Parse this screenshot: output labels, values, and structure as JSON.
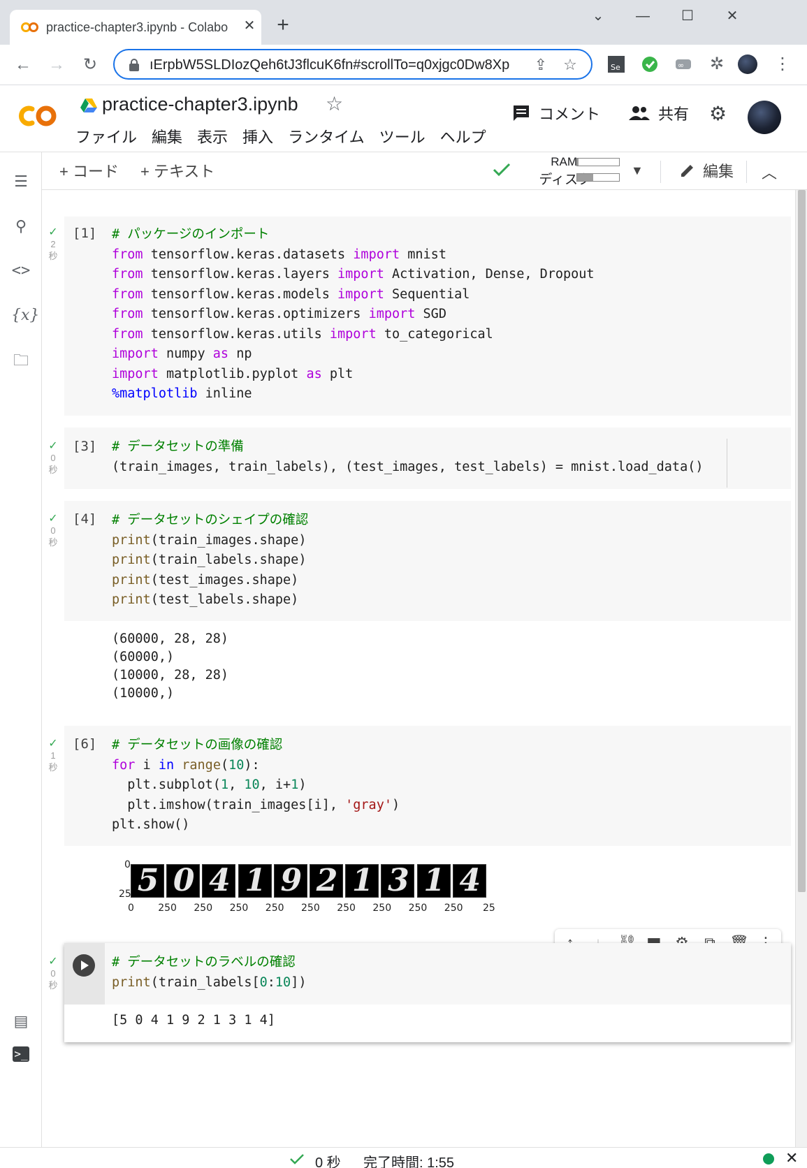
{
  "browser": {
    "tab_title": "practice-chapter3.ipynb - Colabo",
    "tab_close": "✕",
    "new_tab": "+",
    "url": "ıErpbW5SLDIozQeh6tJ3flcuK6fn#scrollTo=q0xjgc0Dw8Xp",
    "window_controls": [
      "⌄",
      "—",
      "☐",
      "✕"
    ]
  },
  "colab": {
    "notebook_title": "practice-chapter3.ipynb",
    "menu": [
      "ファイル",
      "編集",
      "表示",
      "挿入",
      "ランタイム",
      "ツール",
      "ヘルプ"
    ],
    "comment_label": "コメント",
    "share_label": "共有",
    "add_code_label": "+ コード",
    "add_text_label": "+ テキスト",
    "ram_label": "RAM",
    "disk_label": "ディスク",
    "ram_usage": 0.03,
    "disk_usage": 0.38,
    "edit_label": "編集"
  },
  "cells": [
    {
      "exec_count": "[1]",
      "status_time": "2",
      "status_unit": "秒"
    },
    {
      "exec_count": "[3]",
      "status_time": "0",
      "status_unit": "秒"
    },
    {
      "exec_count": "[4]",
      "status_time": "0",
      "status_unit": "秒"
    },
    {
      "exec_count": "[6]",
      "status_time": "1",
      "status_unit": "秒"
    },
    {
      "exec_count": "",
      "status_time": "0",
      "status_unit": "秒"
    }
  ],
  "code": {
    "c1_l1": "# パッケージのインポート",
    "c1_l2a": "from",
    "c1_l2b": " tensorflow.keras.datasets ",
    "c1_l2c": "import",
    "c1_l2d": " mnist",
    "c1_l3a": "from",
    "c1_l3b": " tensorflow.keras.layers ",
    "c1_l3c": "import",
    "c1_l3d": " Activation, Dense, Dropout",
    "c1_l4a": "from",
    "c1_l4b": " tensorflow.keras.models ",
    "c1_l4c": "import",
    "c1_l4d": " Sequential",
    "c1_l5a": "from",
    "c1_l5b": " tensorflow.keras.optimizers ",
    "c1_l5c": "import",
    "c1_l5d": " SGD",
    "c1_l6a": "from",
    "c1_l6b": " tensorflow.keras.utils ",
    "c1_l6c": "import",
    "c1_l6d": " to_categorical",
    "c1_l7a": "import",
    "c1_l7b": " numpy ",
    "c1_l7c": "as",
    "c1_l7d": " np",
    "c1_l8a": "import",
    "c1_l8b": " matplotlib.pyplot ",
    "c1_l8c": "as",
    "c1_l8d": " plt",
    "c1_l9a": "%matplotlib",
    "c1_l9b": " inline",
    "c2_l1": "# データセットの準備",
    "c2_l2": "(train_images, train_labels), (test_images, test_labels) = mnist.load_data()",
    "c3_l1": "# データセットのシェイプの確認",
    "c3_fn": "print",
    "c3_l2": "(train_images.shape)",
    "c3_l3": "(train_labels.shape)",
    "c3_l4": "(test_images.shape)",
    "c3_l5": "(test_labels.shape)",
    "c4_l1": "# データセットの画像の確認",
    "c4_l2a": "for",
    "c4_l2b": " i ",
    "c4_l2c": "in",
    "c4_l2d": " ",
    "c4_l2e": "range",
    "c4_l2f": "(",
    "c4_l2g": "10",
    "c4_l2h": "):",
    "c4_l3a": "  plt.subplot(",
    "c4_l3b": "1",
    "c4_l3c": ", ",
    "c4_l3d": "10",
    "c4_l3e": ", i+",
    "c4_l3f": "1",
    "c4_l3g": ")",
    "c4_l4a": "  plt.imshow(train_images[i], ",
    "c4_l4b": "'gray'",
    "c4_l4c": ")",
    "c4_l5": "plt.show()",
    "c5_l1": "# データセットのラベルの確認",
    "c5_l2a": "print",
    "c5_l2b": "(train_labels[",
    "c5_l2c": "0",
    "c5_l2d": ":",
    "c5_l2e": "10",
    "c5_l2f": "])"
  },
  "outputs": {
    "shape_lines": [
      "(60000, 28, 28)",
      "(60000,)",
      "(10000, 28, 28)",
      "(10000,)"
    ],
    "labels_output": "[5 0 4 1 9 2 1 3 1 4]"
  },
  "figure": {
    "digits": [
      "5",
      "0",
      "4",
      "1",
      "9",
      "2",
      "1",
      "3",
      "1",
      "4"
    ],
    "yticks": [
      "0",
      "25"
    ],
    "xticks": [
      "0",
      "250",
      "250",
      "250",
      "250",
      "250",
      "250",
      "250",
      "250",
      "250",
      "25"
    ]
  },
  "status": {
    "time": "0 秒",
    "completed": "完了時間: 1:55"
  },
  "colors": {
    "accent": "#1a73e8",
    "success": "#34a853",
    "colab_orange": "#f9ab00",
    "keyword": "#af00db",
    "comment": "#008000"
  }
}
